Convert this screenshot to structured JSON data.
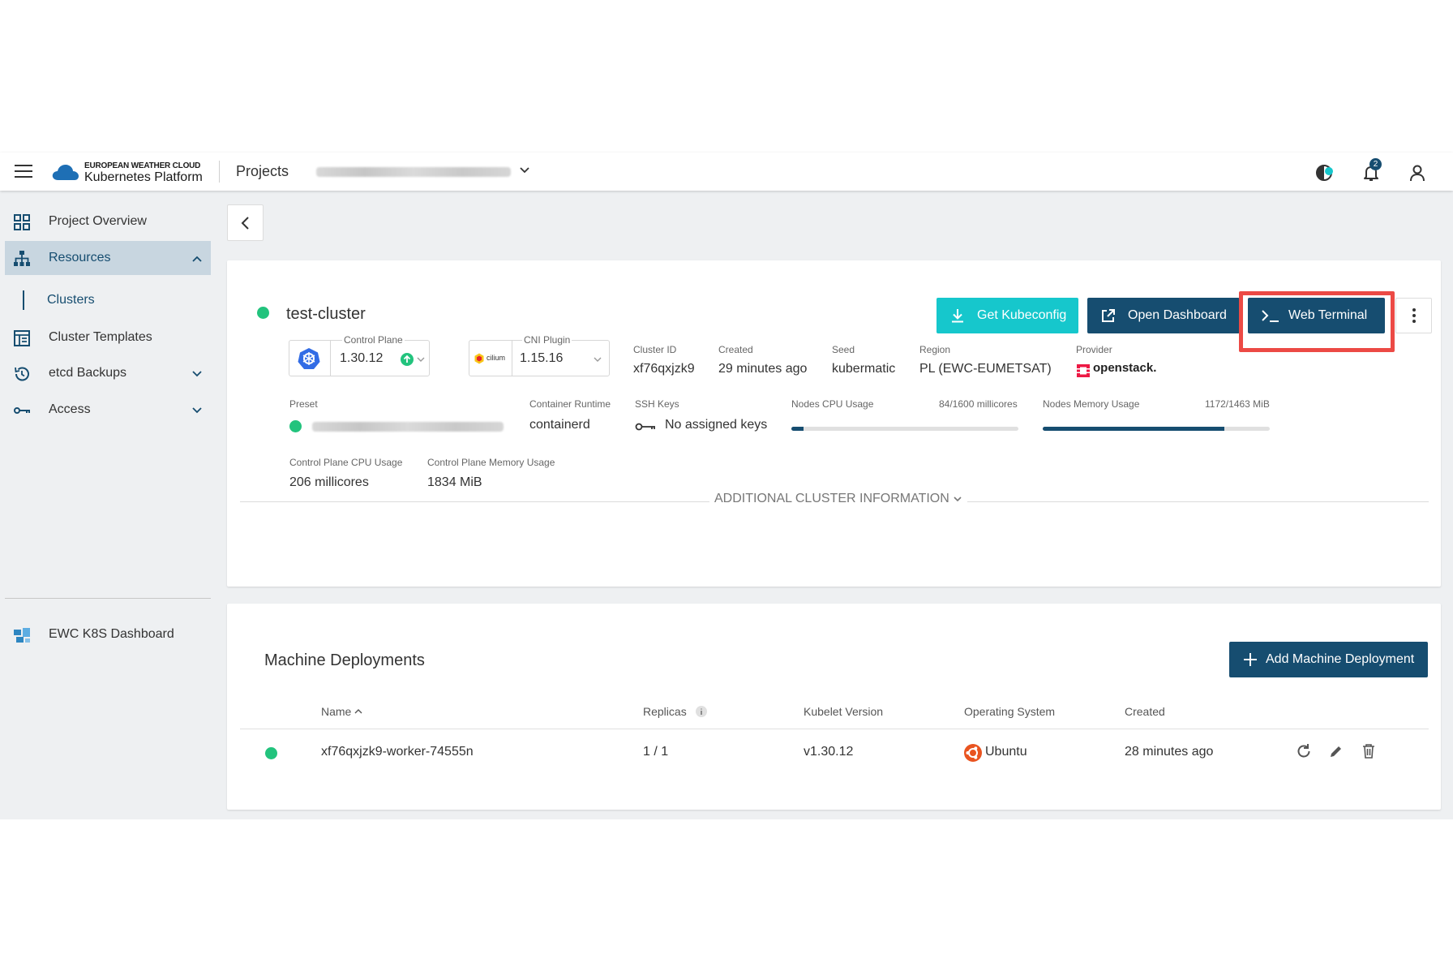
{
  "header": {
    "logo_line1": "EUROPEAN WEATHER CLOUD",
    "logo_line2": "Kubernetes Platform",
    "projects_label": "Projects",
    "notification_count": "2"
  },
  "sidebar": {
    "items": [
      {
        "label": "Project Overview",
        "icon": "grid-icon"
      },
      {
        "label": "Resources",
        "icon": "sitemap-icon"
      },
      {
        "label": "Clusters"
      },
      {
        "label": "Cluster Templates",
        "icon": "template-icon"
      },
      {
        "label": "etcd Backups",
        "icon": "history-icon"
      },
      {
        "label": "Access",
        "icon": "key-icon"
      }
    ],
    "external": {
      "label": "EWC K8S Dashboard",
      "icon": "dashboard-icon"
    }
  },
  "cluster": {
    "name": "test-cluster",
    "buttons": {
      "kubeconfig": "Get Kubeconfig",
      "dashboard": "Open Dashboard",
      "terminal": "Web Terminal"
    },
    "control_plane": {
      "label": "Control Plane",
      "value": "1.30.12"
    },
    "cni_plugin": {
      "label": "CNI Plugin",
      "value": "1.15.16",
      "logo_text": "cilium"
    },
    "cluster_id": {
      "label": "Cluster ID",
      "value": "xf76qxjzk9"
    },
    "created": {
      "label": "Created",
      "value": "29 minutes ago"
    },
    "seed": {
      "label": "Seed",
      "value": "kubermatic"
    },
    "region": {
      "label": "Region",
      "value": "PL (EWC-EUMETSAT)"
    },
    "provider": {
      "label": "Provider",
      "value": "openstack."
    },
    "preset": {
      "label": "Preset"
    },
    "container_runtime": {
      "label": "Container Runtime",
      "value": "containerd"
    },
    "ssh_keys": {
      "label": "SSH Keys",
      "value": "No assigned keys"
    },
    "nodes_cpu": {
      "label": "Nodes CPU Usage",
      "value": "84/1600 millicores",
      "fraction": 0.0525
    },
    "nodes_memory": {
      "label": "Nodes Memory Usage",
      "value": "1172/1463 MiB",
      "fraction": 0.801
    },
    "cp_cpu": {
      "label": "Control Plane CPU Usage",
      "value": "206 millicores"
    },
    "cp_memory": {
      "label": "Control Plane Memory Usage",
      "value": "1834 MiB"
    },
    "additional_info": "ADDITIONAL CLUSTER INFORMATION"
  },
  "machine_deployments": {
    "title": "Machine Deployments",
    "add_button": "Add Machine Deployment",
    "columns": {
      "name": "Name",
      "replicas": "Replicas",
      "kubelet": "Kubelet Version",
      "os": "Operating System",
      "created": "Created"
    },
    "rows": [
      {
        "name": "xf76qxjzk9-worker-74555n",
        "replicas": "1 / 1",
        "kubelet": "v1.30.12",
        "os": "Ubuntu",
        "created": "28 minutes ago"
      }
    ]
  },
  "colors": {
    "accent_navy": "#164d70",
    "accent_teal": "#16c7cc",
    "status_green": "#22c37d",
    "highlight_red": "#ec4a45"
  }
}
